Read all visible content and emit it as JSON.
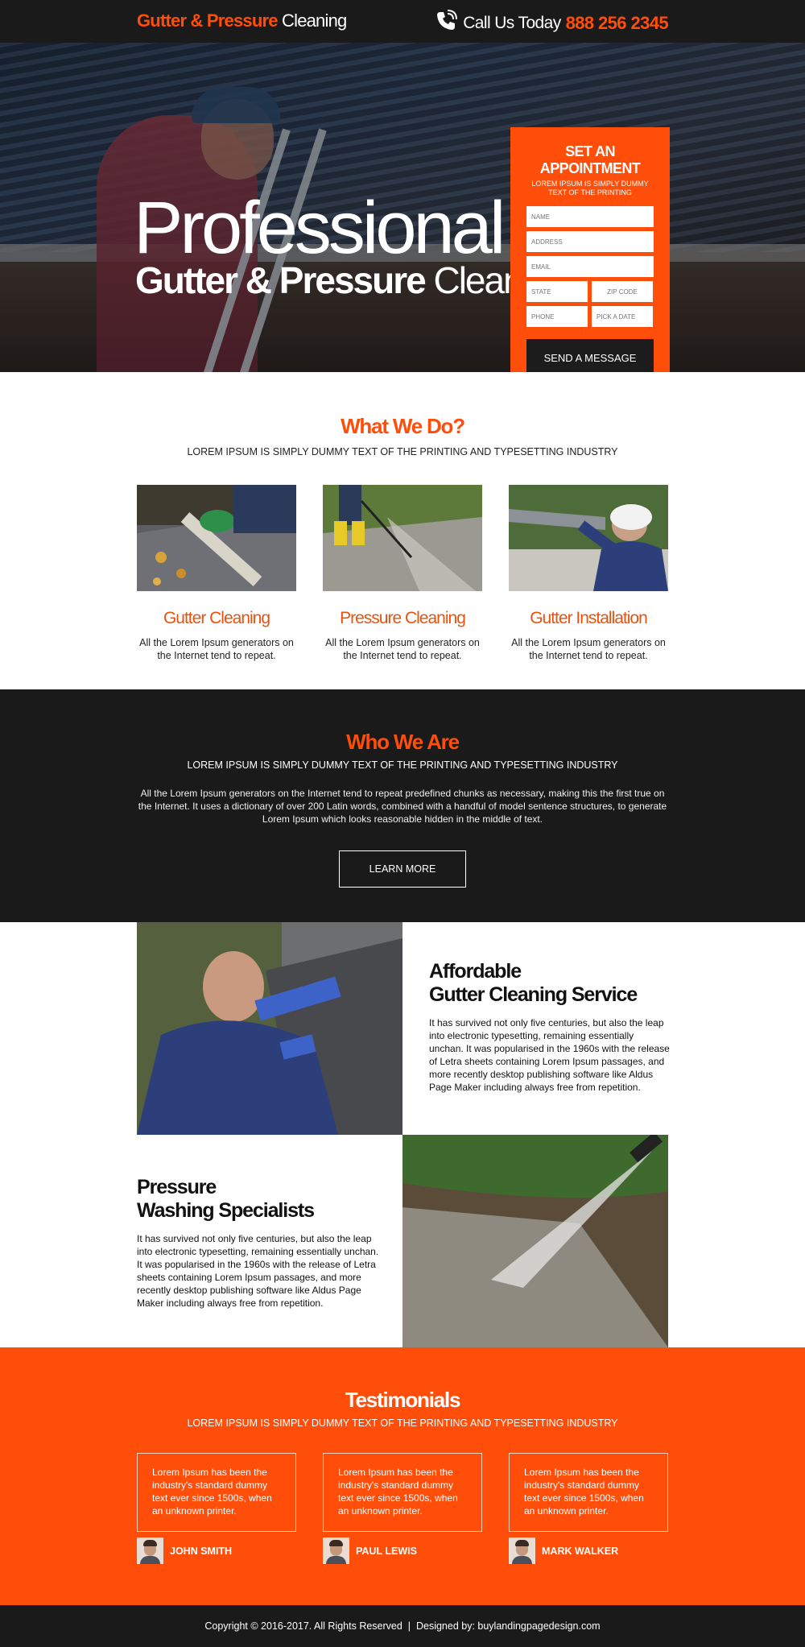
{
  "header": {
    "logo_bold": "Gutter & Pressure",
    "logo_light": "Cleaning",
    "call_label": "Call Us Today",
    "phone": "888 256 2345"
  },
  "hero": {
    "title_line1": "Professional",
    "title_bold": "Gutter & Pressure",
    "title_light": "Cleaning"
  },
  "form": {
    "title": "SET AN APPOINTMENT",
    "subtitle": "LOREM IPSUM IS SIMPLY DUMMY TEXT OF THE PRINTING",
    "name_placeholder": "NAME",
    "address_placeholder": "ADDRESS",
    "email_placeholder": "EMAIL",
    "state_placeholder": "STATE",
    "zip_placeholder": "ZIP CODE",
    "phone_placeholder": "PHONE",
    "date_placeholder": "PICK A DATE",
    "submit_label": "SEND A MESSAGE"
  },
  "what_we_do": {
    "title": "What We Do?",
    "subtitle": "LOREM IPSUM IS SIMPLY DUMMY TEXT OF THE PRINTING AND TYPESETTING INDUSTRY",
    "services": [
      {
        "title": "Gutter Cleaning",
        "desc": "All the Lorem Ipsum generators on the Internet tend to repeat."
      },
      {
        "title": "Pressure Cleaning",
        "desc": "All the Lorem Ipsum generators on the Internet tend to repeat."
      },
      {
        "title": "Gutter Installation",
        "desc": "All the Lorem Ipsum generators on the Internet tend to repeat."
      }
    ]
  },
  "who_we_are": {
    "title": "Who We Are",
    "subtitle": "LOREM IPSUM IS SIMPLY DUMMY TEXT OF THE PRINTING AND TYPESETTING INDUSTRY",
    "paragraph": "All the Lorem Ipsum generators on the Internet tend to repeat predefined chunks as necessary, making this the first true on the Internet. It uses a dictionary of over 200 Latin words, combined with a handful of model sentence structures, to generate Lorem Ipsum which looks reasonable hidden in the middle of text.",
    "button_label": "LEARN MORE"
  },
  "features": [
    {
      "title_line1": "Affordable",
      "title_line2": "Gutter Cleaning Service",
      "text": "It has survived not only five centuries, but also the leap into electronic typesetting, remaining essentially unchan. It was popularised in the 1960s with the release of Letra sheets containing Lorem Ipsum passages, and more recently desktop publishing software like Aldus Page Maker including always free from repetition."
    },
    {
      "title_line1": "Pressure",
      "title_line2": "Washing Specialists",
      "text": "It has survived not only five centuries, but also the leap into electronic typesetting, remaining essentially unchan. It was popularised in the 1960s with the release of Letra sheets containing Lorem Ipsum passages, and more recently desktop publishing software like Aldus Page Maker including always free from repetition."
    }
  ],
  "testimonials": {
    "title": "Testimonials",
    "subtitle": "LOREM IPSUM IS SIMPLY DUMMY TEXT OF THE PRINTING AND TYPESETTING INDUSTRY",
    "items": [
      {
        "quote": "Lorem Ipsum has been the industry's standard dummy text ever since 1500s, when an unknown printer.",
        "name": "JOHN SMITH"
      },
      {
        "quote": "Lorem Ipsum has been the industry's standard dummy text ever since 1500s, when an unknown printer.",
        "name": "PAUL LEWIS"
      },
      {
        "quote": "Lorem Ipsum has been the industry's standard dummy text ever since 1500s, when an unknown printer.",
        "name": "MARK WALKER"
      }
    ]
  },
  "footer": {
    "text": "Copyright © 2016-2017. All Rights Reserved  |  Designed by: buylandingpagedesign.com"
  },
  "colors": {
    "accent": "#ff4d0a",
    "dark": "#1a1a1a"
  }
}
